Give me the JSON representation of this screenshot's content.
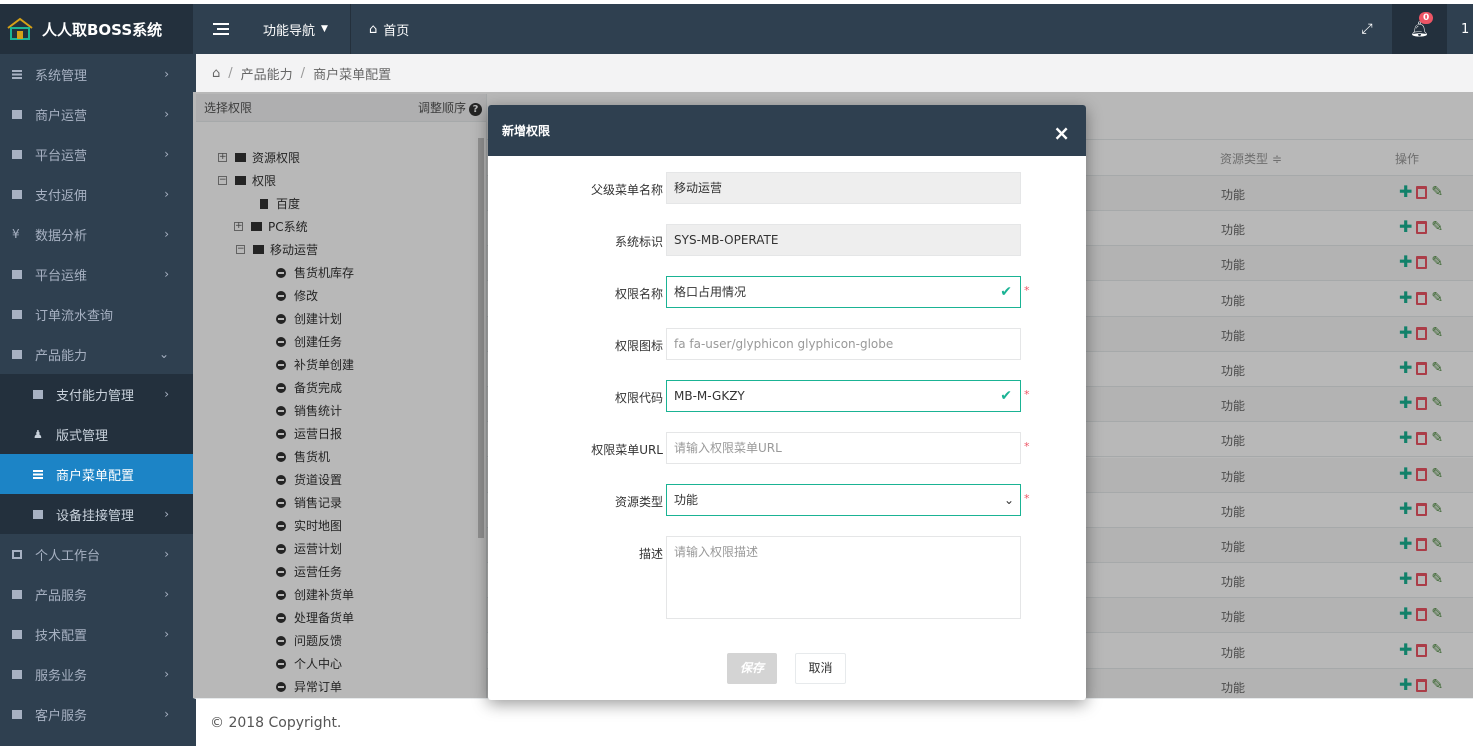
{
  "app": {
    "title": "人人取BOSS系统",
    "func_nav": "功能导航",
    "home": "首页",
    "notification_count": "0",
    "user_initial": "1"
  },
  "sidebar": {
    "items": [
      {
        "label": "系统管理",
        "icon": "grid-icon"
      },
      {
        "label": "商户运营",
        "icon": "square-icon"
      },
      {
        "label": "平台运营",
        "icon": "square-icon"
      },
      {
        "label": "支付返佣",
        "icon": "square-icon"
      },
      {
        "label": "数据分析",
        "icon": "yen-icon"
      },
      {
        "label": "平台运维",
        "icon": "square-icon"
      },
      {
        "label": "订单流水查询",
        "icon": "square-icon"
      },
      {
        "label": "产品能力",
        "icon": "square-icon"
      }
    ],
    "sub_items": [
      {
        "label": "支付能力管理",
        "icon": "square-icon"
      },
      {
        "label": "版式管理",
        "icon": "user-icon"
      },
      {
        "label": "商户菜单配置",
        "icon": "grid-icon"
      },
      {
        "label": "设备挂接管理",
        "icon": "square-icon"
      }
    ],
    "items_after": [
      {
        "label": "个人工作台",
        "icon": "desktop-icon"
      },
      {
        "label": "产品服务",
        "icon": "square-icon"
      },
      {
        "label": "技术配置",
        "icon": "square-icon"
      },
      {
        "label": "服务业务",
        "icon": "square-icon"
      },
      {
        "label": "客户服务",
        "icon": "square-icon"
      }
    ]
  },
  "breadcrumb": {
    "items": [
      "产品能力",
      "商户菜单配置"
    ]
  },
  "tree": {
    "header_label": "选择权限",
    "reorder_label": "调整顺序",
    "nodes": [
      {
        "label": "资源权限",
        "kind": "folder",
        "toggle": "+"
      },
      {
        "label": "权限",
        "kind": "folder-open",
        "toggle": "−"
      },
      {
        "label": "百度",
        "kind": "doc"
      },
      {
        "label": "PC系统",
        "kind": "folder",
        "toggle": "+"
      },
      {
        "label": "移动运营",
        "kind": "folder-open",
        "toggle": "−"
      },
      {
        "label": "售货机库存",
        "kind": "leaf"
      },
      {
        "label": "修改",
        "kind": "leaf"
      },
      {
        "label": "创建计划",
        "kind": "leaf"
      },
      {
        "label": "创建任务",
        "kind": "leaf"
      },
      {
        "label": "补货单创建",
        "kind": "leaf"
      },
      {
        "label": "备货完成",
        "kind": "leaf"
      },
      {
        "label": "销售统计",
        "kind": "leaf"
      },
      {
        "label": "运营日报",
        "kind": "leaf"
      },
      {
        "label": "售货机",
        "kind": "leaf"
      },
      {
        "label": "货道设置",
        "kind": "leaf"
      },
      {
        "label": "销售记录",
        "kind": "leaf"
      },
      {
        "label": "实时地图",
        "kind": "leaf"
      },
      {
        "label": "运营计划",
        "kind": "leaf"
      },
      {
        "label": "运营任务",
        "kind": "leaf"
      },
      {
        "label": "创建补货单",
        "kind": "leaf"
      },
      {
        "label": "处理备货单",
        "kind": "leaf"
      },
      {
        "label": "问题反馈",
        "kind": "leaf"
      },
      {
        "label": "个人中心",
        "kind": "leaf"
      },
      {
        "label": "异常订单",
        "kind": "leaf"
      }
    ]
  },
  "table": {
    "col_type": "资源类型 ≑",
    "col_ops": "操作",
    "rows": [
      "功能",
      "功能",
      "功能",
      "功能",
      "功能",
      "功能",
      "功能",
      "功能",
      "功能",
      "功能",
      "功能",
      "功能",
      "功能",
      "功能",
      "功能"
    ]
  },
  "footer": {
    "text": "© 2018 Copyright."
  },
  "modal": {
    "title": "新增权限",
    "close": "×",
    "fields": {
      "parent_label": "父级菜单名称",
      "parent_value": "移动运营",
      "system_label": "系统标识",
      "system_value": "SYS-MB-OPERATE",
      "name_label": "权限名称",
      "name_value": "格口占用情况",
      "icon_label": "权限图标",
      "icon_placeholder": "fa fa-user/glyphicon glyphicon-globe",
      "code_label": "权限代码",
      "code_value": "MB-M-GKZY",
      "url_label": "权限菜单URL",
      "url_placeholder": "请输入权限菜单URL",
      "type_label": "资源类型",
      "type_value": "功能",
      "desc_label": "描述",
      "desc_placeholder": "请输入权限描述"
    },
    "required_mark": "*",
    "save": "保存",
    "cancel": "取消"
  },
  "colors": {
    "sidebar_bg": "#2f4050",
    "active_item": "#1c84c6",
    "valid_border": "#1ab394",
    "danger": "#ed5565"
  }
}
